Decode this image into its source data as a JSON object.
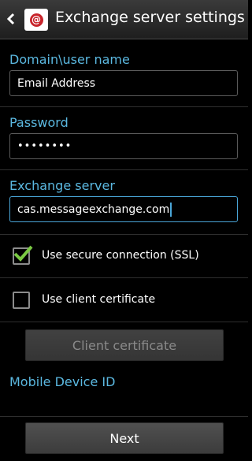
{
  "header": {
    "title": "Exchange server settings",
    "back_icon": "chevron-left-icon",
    "app_icon": "email-at-icon",
    "app_icon_glyph": "@"
  },
  "form": {
    "domain_label": "Domain\\user name",
    "domain_value": "Email Address",
    "password_label": "Password",
    "password_value": "••••••••",
    "server_label": "Exchange server",
    "server_value": "cas.messageexchange.com"
  },
  "options": {
    "ssl_label": "Use secure connection (SSL)",
    "ssl_checked": true,
    "client_cert_label": "Use client certificate",
    "client_cert_checked": false
  },
  "buttons": {
    "client_certificate": "Client certificate",
    "next": "Next"
  },
  "mobile_device_id_label": "Mobile Device ID",
  "colors": {
    "accent": "#5bb8e0",
    "check": "#7ac943",
    "brand_red": "#c8242b"
  }
}
